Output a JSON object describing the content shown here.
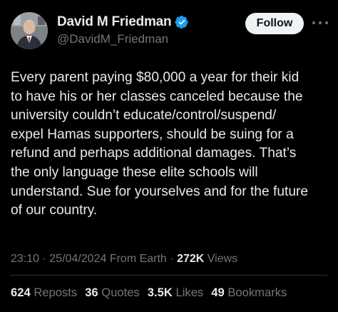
{
  "author": {
    "display_name": "David M Friedman",
    "handle": "@DavidM_Friedman",
    "verified_icon": "verified-badge-icon",
    "verified_color": "#1d9bf0"
  },
  "actions": {
    "follow_label": "Follow",
    "more_icon": "more-horizontal-icon"
  },
  "post": {
    "text": "Every parent paying $80,000 a year for their kid\nto have his or her classes canceled because the\nuniversity couldn’t educate/control/suspend/\nexpel Hamas supporters, should be suing for a\nrefund and perhaps additional damages. That’s\nthe only language these elite schools will\nunderstand. Sue for yourselves and for the future\nof our country."
  },
  "meta": {
    "time": "23:10",
    "date": "25/04/2024",
    "source": "From Earth",
    "separator": "·",
    "views_count": "272K",
    "views_label": "Views"
  },
  "stats": {
    "reposts_count": "624",
    "reposts_label": "Reposts",
    "quotes_count": "36",
    "quotes_label": "Quotes",
    "likes_count": "3.5K",
    "likes_label": "Likes",
    "bookmarks_count": "49",
    "bookmarks_label": "Bookmarks"
  },
  "colors": {
    "background": "#000000",
    "primary_text": "#e7e9ea",
    "secondary_text": "#71767b",
    "divider": "#2f3336",
    "follow_button_bg": "#eff3f4"
  }
}
